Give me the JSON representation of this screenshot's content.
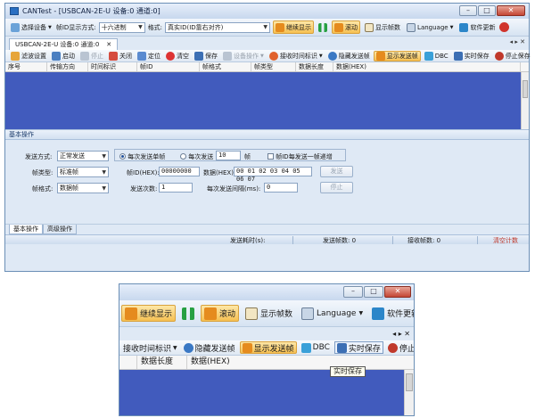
{
  "window": {
    "title": "CANTest - [USBCAN-2E-U 设备:0 通道:0]"
  },
  "toolbar": {
    "select_device": "选择设备",
    "frame_id_mode_label": "帧ID显示方式:",
    "frame_id_mode_value": "十六进制",
    "format_label": "格式:",
    "format_value": "真实ID(ID靠右对齐)",
    "continue_display": "继续显示",
    "scroll": "滚动",
    "show_frame_count": "显示帧数",
    "language": "Language",
    "software_update": "软件更新"
  },
  "tab": {
    "label": "USBCAN-2E-U 设备:0 通道:0"
  },
  "toolbar2": {
    "filter_settings": "滤波设置",
    "start": "启动",
    "stop": "停止",
    "close": "关闭",
    "locate": "定位",
    "clear": "清空",
    "save": "保存",
    "device_ops": "设备操作",
    "recv_time_mark": "接收时间标识",
    "hide_send_frames": "隐藏发送帧",
    "show_send_frames": "显示发送帧",
    "dbc": "DBC",
    "realtime_save": "实时保存",
    "stop_save": "停止保存"
  },
  "grid": {
    "columns": [
      "序号",
      "传输方向",
      "时间标识",
      "帧ID",
      "帧格式",
      "帧类型",
      "数据长度",
      "数据(HEX)"
    ]
  },
  "basic_ops": {
    "title": "基本操作",
    "send_mode_label": "发送方式:",
    "send_mode_value": "正常发送",
    "single_frame_label": "每次发送单帧",
    "multi_frame_prefix": "每次发送",
    "multi_frame_count": "10",
    "multi_frame_suffix": "帧",
    "frame_id_increment_label": "帧ID每发送一帧递增",
    "frame_type_label": "帧类型:",
    "frame_type_value": "标准帧",
    "frame_id_label": "帧ID(HEX):",
    "frame_id_value": "00000000",
    "data_label": "数据(HEX):",
    "data_value": "00 01 02 03 04 05 06 07",
    "send_button": "发送",
    "frame_format_label": "帧格式:",
    "frame_format_value": "数据帧",
    "send_count_label": "发送次数:",
    "send_count_value": "1",
    "interval_label": "每次发送间隔(ms):",
    "interval_value": "0",
    "stop_button": "停止"
  },
  "bottom_tabs": {
    "basic": "基本操作",
    "advanced": "高级操作"
  },
  "status": {
    "send_time_label": "发送耗时(s):",
    "send_frames_label": "发送帧数: 0",
    "recv_frames_label": "接收帧数: 0",
    "clear_count": "清空计数"
  },
  "zoom": {
    "continue_display": "继续显示",
    "scroll": "滚动",
    "show_frame_count": "显示帧数",
    "language": "Language",
    "software_update": "软件更新",
    "recv_time_mark": "接收时间标识",
    "hide_send_frames": "隐藏发送帧",
    "show_send_frames": "显示发送帧",
    "dbc": "DBC",
    "realtime_save": "实时保存",
    "stop_save": "停止保存",
    "col_data_length": "数据长度",
    "col_data_hex": "数据(HEX)",
    "tooltip": "实时保存"
  },
  "colors": {
    "grid_bg": "#415bbd",
    "accent_red": "#c0392b"
  }
}
